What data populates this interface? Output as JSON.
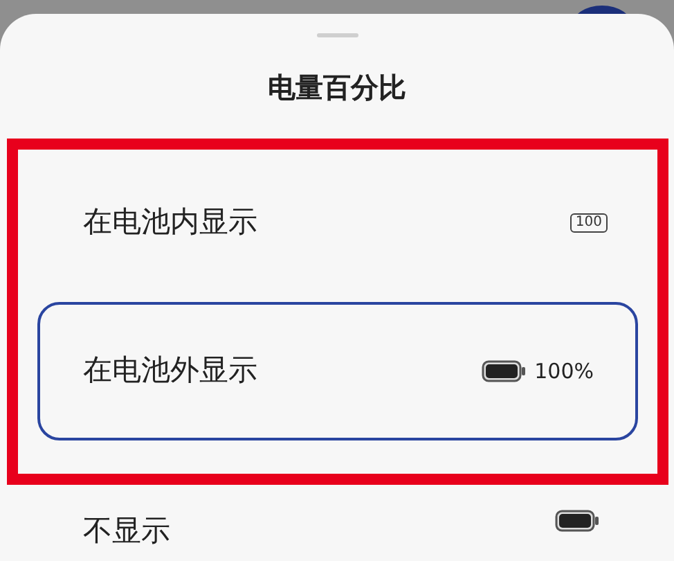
{
  "sheet": {
    "title": "电量百分比"
  },
  "options": [
    {
      "label": "在电池内显示",
      "kind": "inside",
      "icon_text": "100",
      "selected": false,
      "highlighted": true
    },
    {
      "label": "在电池外显示",
      "kind": "outside",
      "reading": "100%",
      "selected": true,
      "highlighted": true
    },
    {
      "label": "不显示",
      "kind": "none",
      "selected": false,
      "highlighted": false
    }
  ],
  "highlight": {
    "color": "#e8001c"
  }
}
